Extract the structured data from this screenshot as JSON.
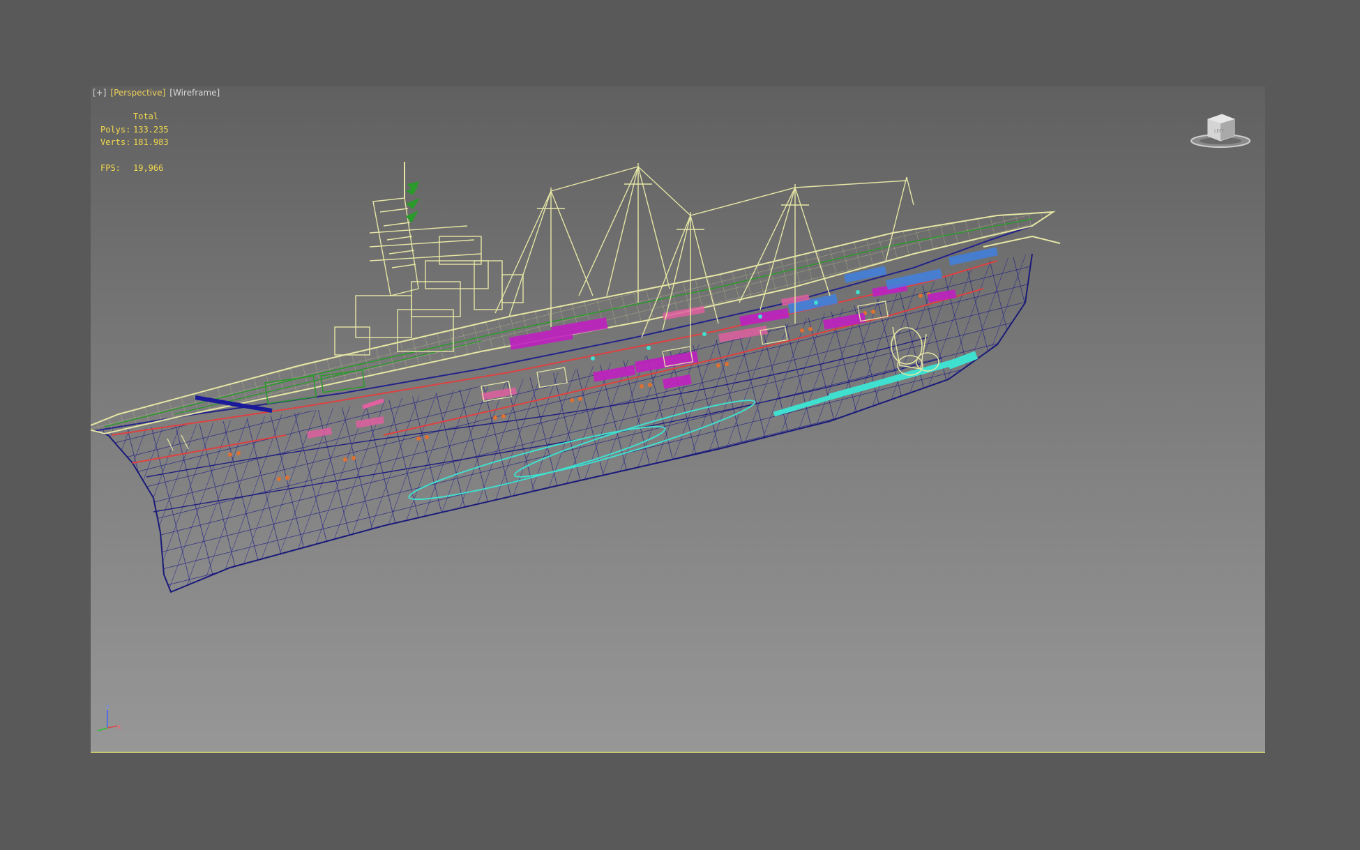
{
  "viewport": {
    "menu_label": "[+]",
    "view_label": "[Perspective]",
    "shading_label": "[Wireframe]"
  },
  "stats": {
    "header": "Total",
    "polys_label": "Polys:",
    "polys_value": "133.235",
    "verts_label": "Verts:",
    "verts_value": "181.983",
    "fps_label": "FPS:",
    "fps_value": "19,966"
  },
  "viewcube": {
    "face_label": "LEFT",
    "icon": "viewcube-icon"
  },
  "axis": {
    "x": "x",
    "z": "z"
  },
  "colors": {
    "hull_wire": "#1a1a7a",
    "superstructure": "#e6e6a6",
    "deck_magenta": "#c020c0",
    "deck_pink": "#e060a0",
    "cyan": "#40e0d0",
    "orange": "#e07030",
    "red": "#e04040",
    "blue": "#4080e0",
    "green": "#2a9a2a",
    "stats_yellow": "#f2d94c"
  }
}
